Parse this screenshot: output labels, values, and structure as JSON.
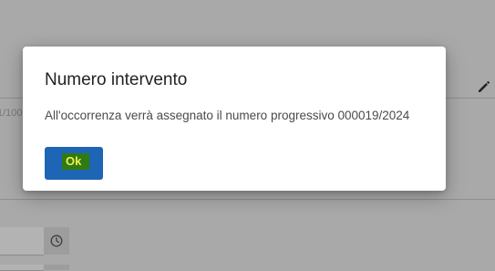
{
  "background": {
    "partial_text": "1/100"
  },
  "dialog": {
    "title": "Numero intervento",
    "message": "All'occorrenza verrà assegnato il numero progressivo 000019/2024",
    "ok_label": "Ok"
  },
  "colors": {
    "primary_button": "#1e65b5",
    "ok_highlight": "#2f7a12",
    "ok_text": "#f3f04a",
    "overlay": "#a9a9a9"
  },
  "icons": {
    "edit": "pencil-icon",
    "time": "clock-icon"
  }
}
